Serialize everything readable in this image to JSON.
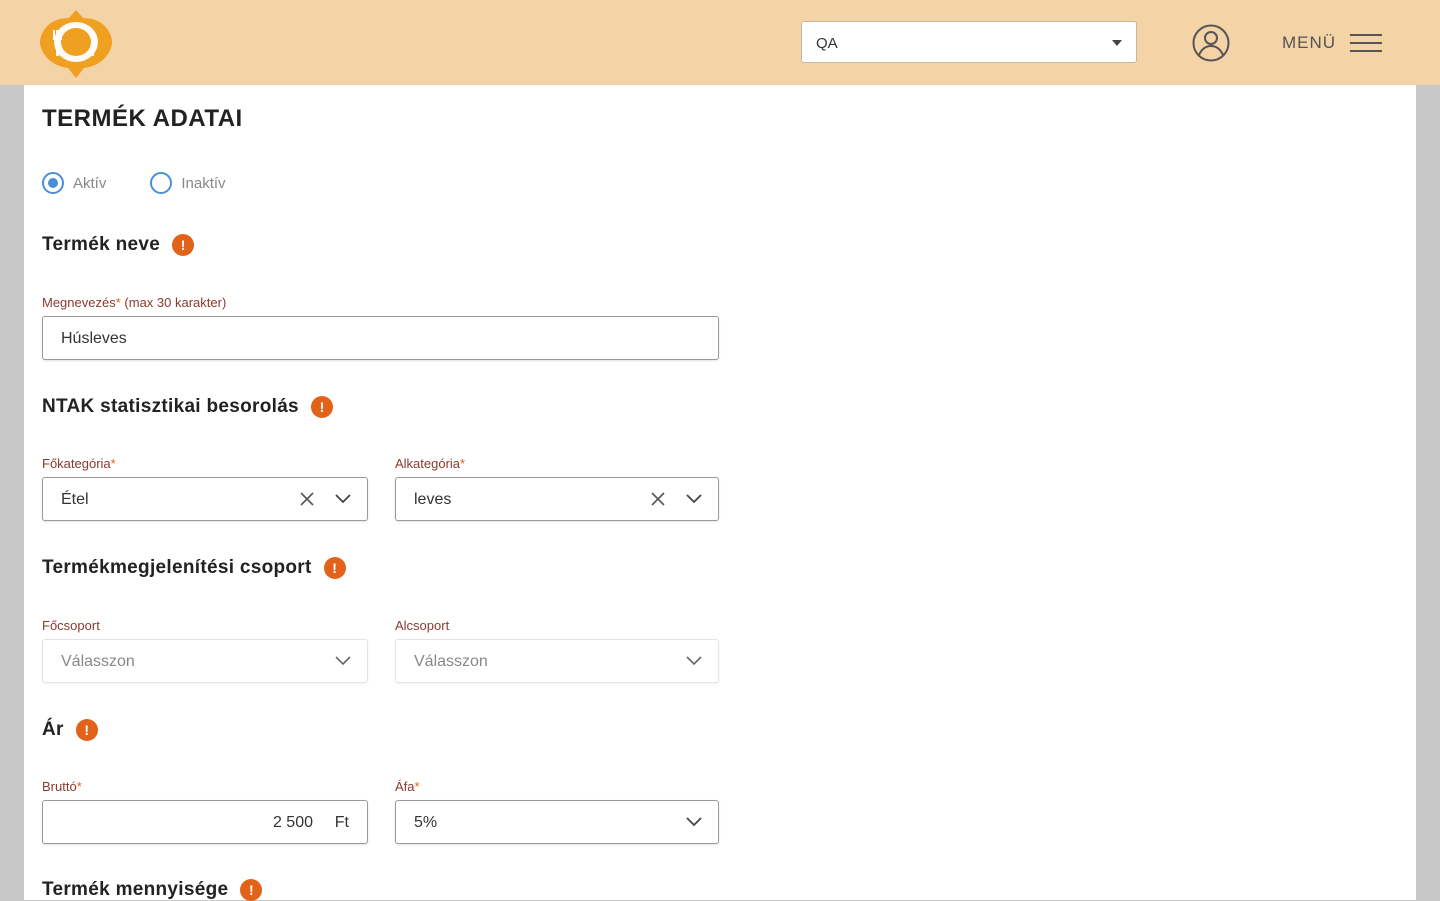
{
  "header": {
    "store_select_value": "QA",
    "menu_label": "MENÜ"
  },
  "page": {
    "title": "TERMÉK ADATAI"
  },
  "status": {
    "options": [
      "Aktív",
      "Inaktív"
    ],
    "selected": "Aktív"
  },
  "sections": {
    "name": "Termék neve",
    "ntak": "NTAK statisztikai besorolás",
    "display_group": "Termékmegjelenítési csoport",
    "price": "Ár",
    "quantity": "Termék mennyisége",
    "info_glyph": "!"
  },
  "name_field": {
    "label": "Megnevezés",
    "required_mark": "*",
    "hint": "(max 30 karakter)",
    "value": "Húsleves"
  },
  "ntak": {
    "main_category_label": "Főkategória",
    "main_category_value": "Étel",
    "sub_category_label": "Alkategória",
    "sub_category_value": "leves",
    "required_mark": "*"
  },
  "display_group": {
    "main_group_label": "Főcsoport",
    "main_group_placeholder": "Válasszon",
    "sub_group_label": "Alcsoport",
    "sub_group_placeholder": "Válasszon"
  },
  "price": {
    "gross_label": "Bruttó",
    "gross_value": "2 500",
    "currency": "Ft",
    "vat_label": "Áfa",
    "vat_value": "5%",
    "required_mark": "*"
  },
  "colors": {
    "header_bg": "#f4d3a6",
    "accent_orange": "#e2621a",
    "radio_blue": "#4a8fd8",
    "label_brown": "#8a3a2e",
    "logo_orange": "#f0a020"
  },
  "icons": {
    "logo": "plate-fork-knife-logo",
    "user": "user-circle-icon",
    "menu": "hamburger-icon",
    "info": "info-icon",
    "clear": "close-icon",
    "dropdown": "chevron-down-icon"
  }
}
